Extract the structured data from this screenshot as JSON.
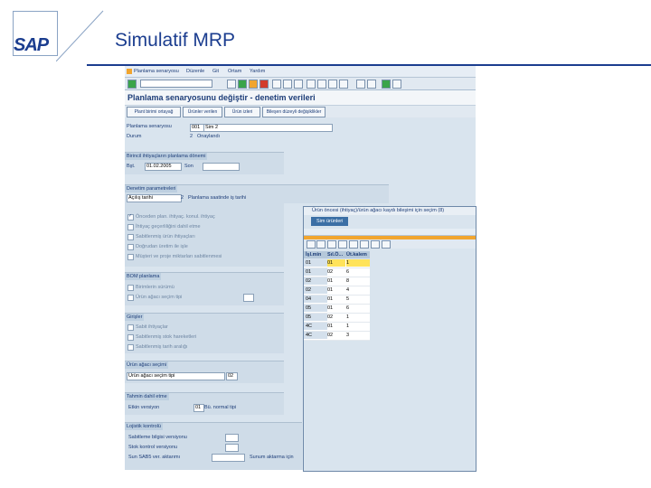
{
  "slide": {
    "title": "Simulatif MRP",
    "logo": "SAP"
  },
  "menubar": {
    "items": [
      "Planlama senaryosu",
      "Düzenle",
      "Git",
      "Ortam",
      "Yardım"
    ]
  },
  "window": {
    "title": "Planlama senaryosunu değiştir - denetim verileri"
  },
  "appbar": {
    "buttons": [
      "Plant birimi ortayağ",
      "Ürünler verilen",
      "Ürün izleri",
      "Bileşen düzeyli değişiklikler"
    ]
  },
  "form": {
    "scenario_label": "Planlama senaryosu",
    "scenario_code": "001",
    "scenario_name": "Sim 2",
    "status_label": "Durum",
    "status_code": "2",
    "status_text": "Onaylandı",
    "group_planning": {
      "title": "Birincil ihtiyaçların planlama dönemi",
      "date_label": "Bşt.",
      "date_value": "01.02.2005",
      "end_label": "Son"
    },
    "group_control": {
      "title": "Denetim parametreleri",
      "option_value": "Açılış tarihi",
      "option_code": "2",
      "option_text": "Planlama saatinde iş tarihi"
    },
    "control_checkboxes": [
      {
        "label": "Önceden plan. ihtiyaç. konul. ihtiyaç",
        "checked": true
      },
      {
        "label": "İhtiyaç geçerliliğini dahil etme",
        "checked": false
      },
      {
        "label": "Sabitlenmiş ürün ihtiyaçları",
        "checked": false
      },
      {
        "label": "Doğrudan üretim ile işle",
        "checked": false
      },
      {
        "label": "Müşteri ve proje miktarları sabitlenmesi",
        "checked": false
      }
    ],
    "group_bom": {
      "title": "BOM planlama",
      "items": [
        "Birimlerin sürümü",
        "Ürün ağacı seçim tipi"
      ]
    },
    "group_other": {
      "title": "Girişler",
      "items": [
        "Sabit ihtiyaçlar",
        "Sabitlenmiş stok hareketleri",
        "Sabitlenmiş tarih aralığı"
      ]
    },
    "group_product": {
      "title": "Ürün ağacı seçimi",
      "field": "Ürün ağacı seçim tipi",
      "code": "02"
    },
    "group_forecast": {
      "title": "Tahmin dahil etme",
      "label": "Etkin versiyon",
      "code": "01",
      "text": "Bü. normal tipi"
    },
    "group_logistics": {
      "title": "Lojistik kontrolü",
      "items": [
        "Sabitleme bilgisi versiyonu",
        "Stok kontrol versiyonu",
        "Sun SAB5 ver. aktarımı"
      ],
      "extra": "Sunum aktarma için"
    }
  },
  "popup": {
    "title": "Ürün öncesi (ihtiyaç)/ürün ağacı kaydı bileşimi için seçim (8)",
    "tab": "Sim ürünleri",
    "table": {
      "headers": [
        "İşl.min",
        "Sıl.Ö...",
        "Üt.kalem"
      ],
      "rows": [
        [
          "01",
          "01",
          "1"
        ],
        [
          "01",
          "02",
          "6"
        ],
        [
          "02",
          "01",
          "8"
        ],
        [
          "02",
          "01",
          "4"
        ],
        [
          "04",
          "01",
          "5"
        ],
        [
          "05",
          "01",
          "6"
        ],
        [
          "05",
          "02",
          "1"
        ],
        [
          "4C",
          "01",
          "1"
        ],
        [
          "4C",
          "02",
          "3"
        ]
      ]
    }
  },
  "colors": {
    "accent_blue": "#1b3d8f",
    "sap_bg": "#d9e4ee",
    "highlight": "#ffe35a",
    "orange_bar": "#f1a52f"
  }
}
